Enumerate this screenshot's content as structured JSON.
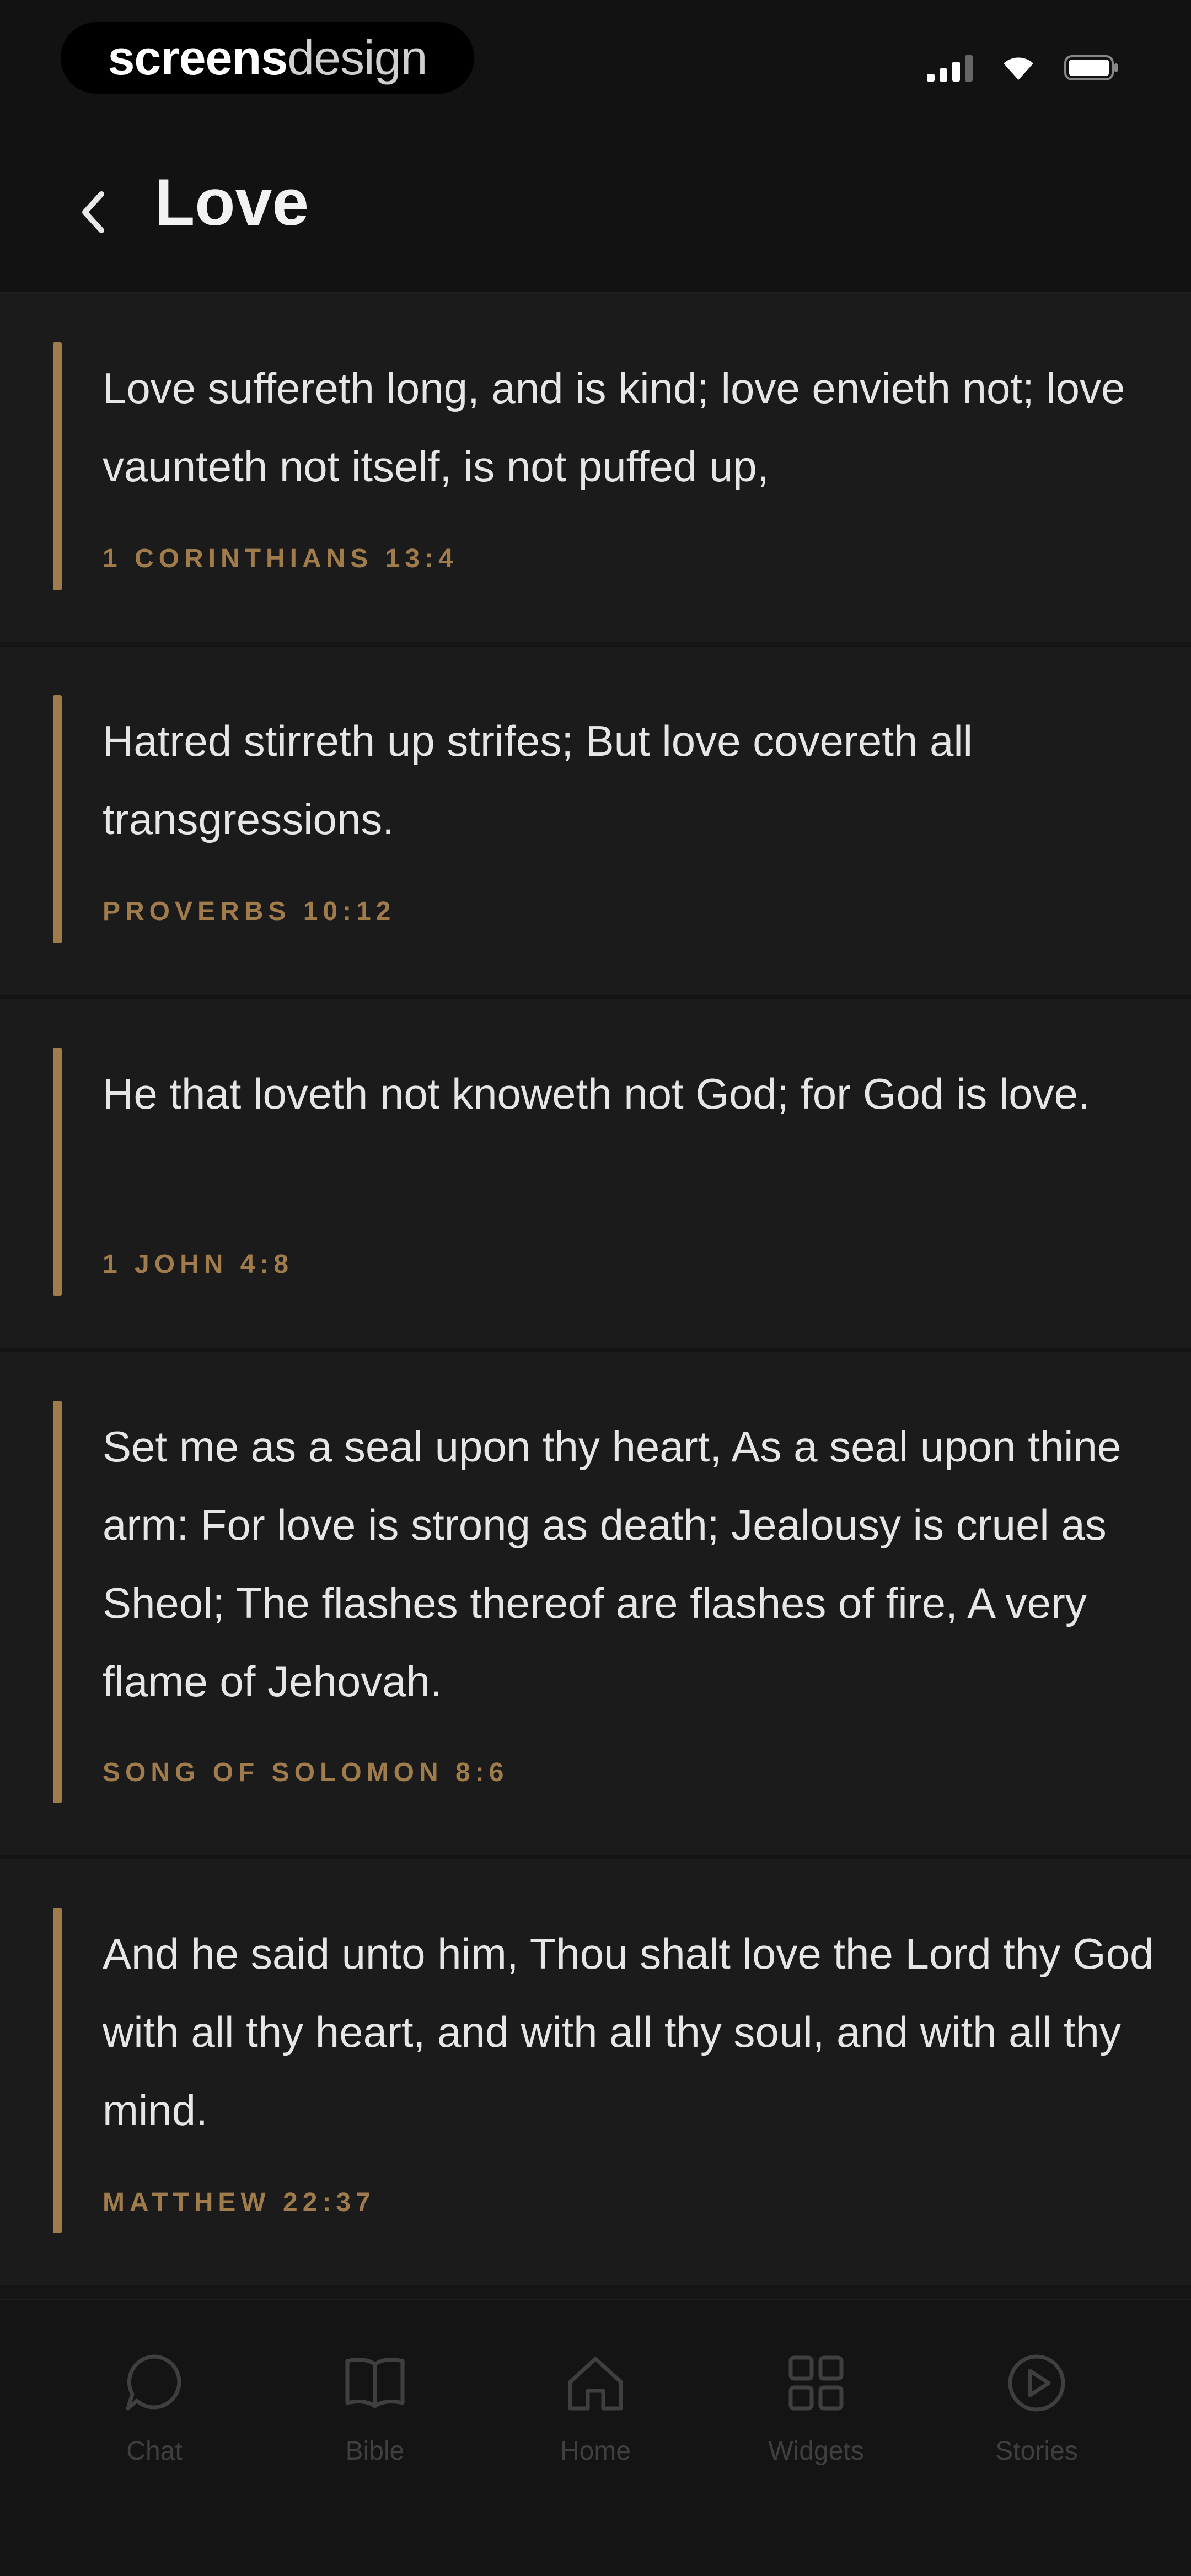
{
  "status_bar": {
    "brand_bold": "screens",
    "brand_light": "design"
  },
  "header": {
    "title": "Love"
  },
  "verses": [
    {
      "text": "Love suffereth long, and is kind; love envieth not; love vaunteth not itself, is not puffed up,",
      "reference": "1 CORINTHIANS 13:4"
    },
    {
      "text": "Hatred stirreth up strifes; But love covereth all transgressions.",
      "reference": "PROVERBS 10:12"
    },
    {
      "text": "He that loveth not knoweth not God; for God is love.",
      "reference": "1 JOHN 4:8"
    },
    {
      "text": "Set me as a seal upon thy heart, As a seal upon thine arm: For love is strong as death; Jealousy is cruel as Sheol; The flashes thereof are flashes of fire, A very flame of Jehovah.",
      "reference": "SONG OF SOLOMON 8:6"
    },
    {
      "text": "And he said unto him, Thou shalt love the Lord thy God with all thy heart, and with all thy soul, and with all thy mind.",
      "reference": "MATTHEW 22:37"
    }
  ],
  "tabs": [
    {
      "label": "Chat",
      "icon": "chat-bubble-icon"
    },
    {
      "label": "Bible",
      "icon": "open-book-icon"
    },
    {
      "label": "Home",
      "icon": "home-icon"
    },
    {
      "label": "Widgets",
      "icon": "grid-icon"
    },
    {
      "label": "Stories",
      "icon": "play-circle-icon"
    }
  ],
  "colors": {
    "accent": "#a07b4c",
    "background": "#161616",
    "card": "#1b1b1b",
    "text": "#e6e6e6",
    "tab_inactive": "#3f3f3f"
  }
}
